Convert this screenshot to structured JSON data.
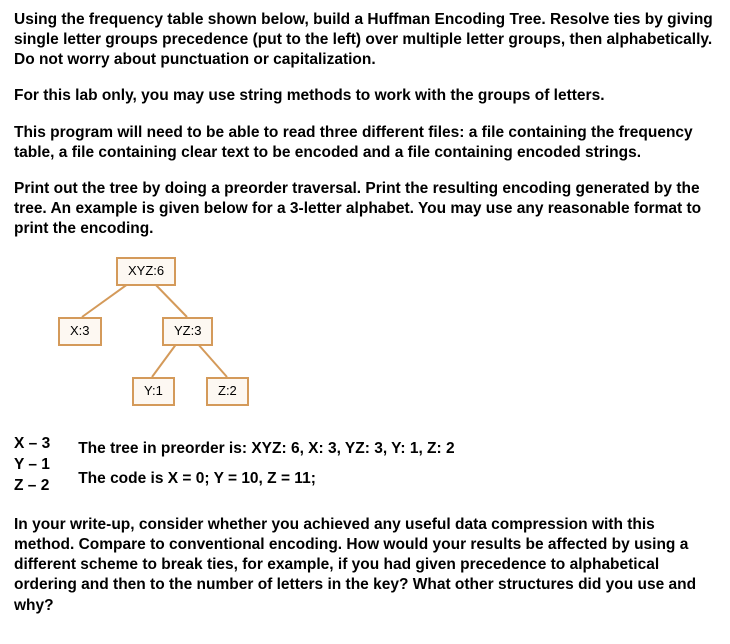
{
  "paragraphs": {
    "p1": "Using the frequency table shown below, build a Huffman Encoding Tree.  Resolve ties by giving single letter groups precedence (put to the left) over multiple letter groups, then alphabetically.  Do not worry about punctuation or capitalization.",
    "p2": "For this lab only, you may use string methods to work with the groups of letters.",
    "p3": "This program will need to be able to read three different files: a file containing the frequency table, a file containing clear text to be encoded and a file containing encoded strings.",
    "p4": "Print out the tree by doing a preorder traversal.  Print the resulting encoding generated by the tree.  An example is given below for a 3-letter alphabet.  You may use any reasonable format to print the encoding.",
    "p5": "In your write-up, consider whether you achieved any useful data compression with this method.  Compare to conventional encoding.  How would your results be affected by using a different scheme to break ties, for example, if you had given precedence to alphabetical ordering and then to the number of letters in the key?  What other structures did you use and why?"
  },
  "tree": {
    "root": "XYZ:6",
    "left": "X:3",
    "right": "YZ:3",
    "rleft": "Y:1",
    "rright": "Z:2"
  },
  "freq": {
    "x": "X – 3",
    "y": "Y – 1",
    "z": "Z – 2"
  },
  "results": {
    "preorder": "The tree in preorder is: XYZ: 6, X: 3, YZ: 3, Y: 1, Z: 2",
    "code": "The code is X = 0; Y = 10, Z = 11;"
  }
}
